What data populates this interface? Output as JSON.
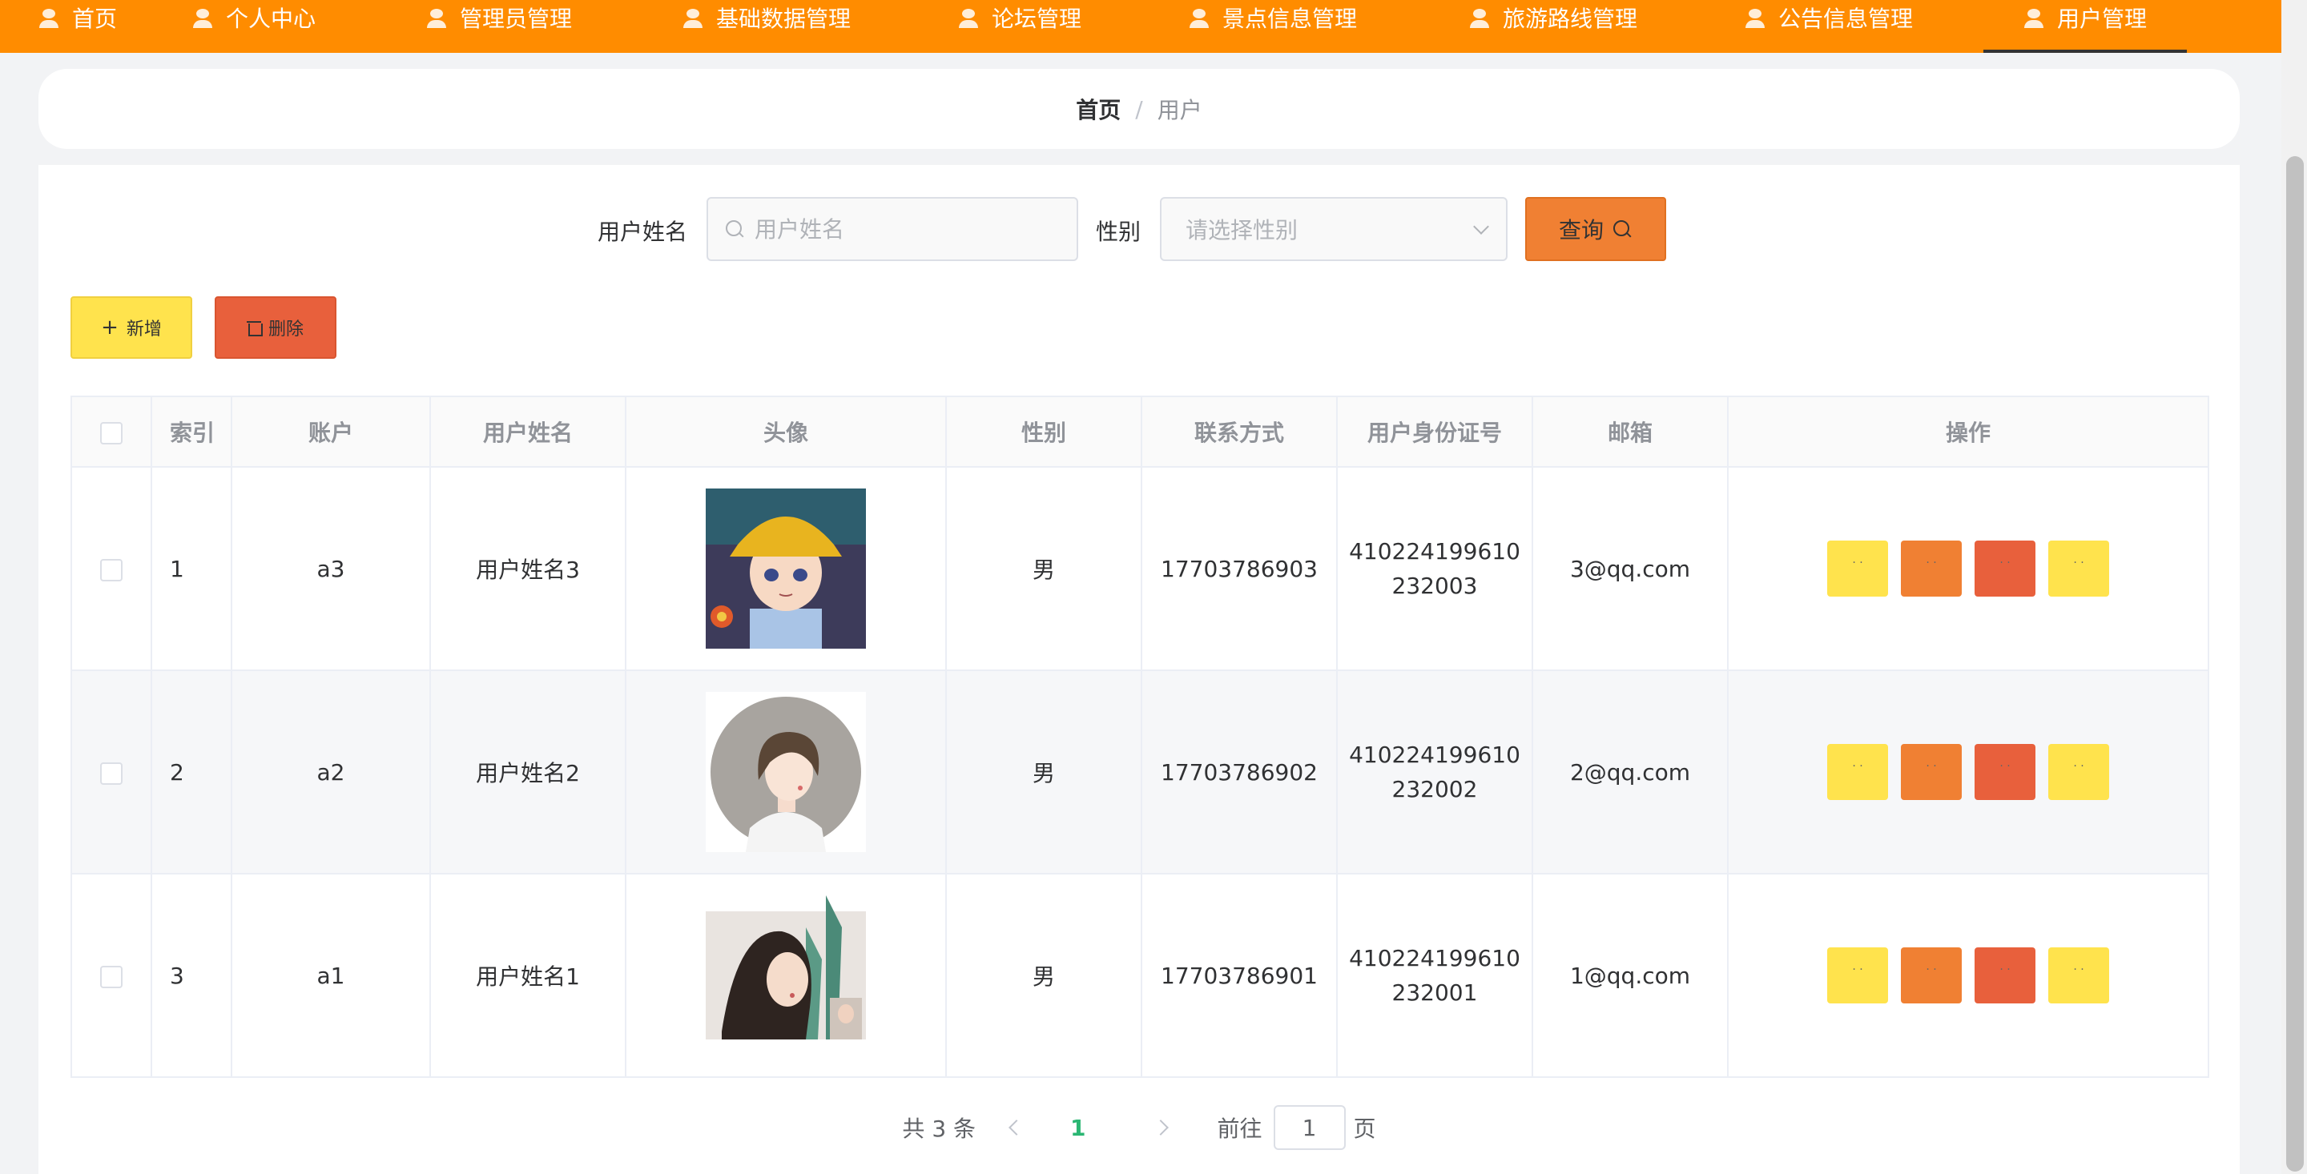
{
  "nav": {
    "items": [
      {
        "label": "首页",
        "icon": "home-icon"
      },
      {
        "label": "个人中心",
        "icon": "user-icon"
      },
      {
        "label": "管理员管理",
        "icon": "user-icon"
      },
      {
        "label": "基础数据管理",
        "icon": "location-icon"
      },
      {
        "label": "论坛管理",
        "icon": "forum-icon"
      },
      {
        "label": "景点信息管理",
        "icon": "user-icon"
      },
      {
        "label": "旅游路线管理",
        "icon": "user-icon"
      },
      {
        "label": "公告信息管理",
        "icon": "notice-icon"
      },
      {
        "label": "用户管理",
        "icon": "user-icon"
      }
    ],
    "active": "用户管理",
    "bg_color": "#ff8c00"
  },
  "breadcrumb": {
    "home": "首页",
    "separator": "/",
    "current": "用户"
  },
  "search": {
    "name_label": "用户姓名",
    "name_placeholder": "用户姓名",
    "gender_label": "性别",
    "gender_placeholder": "请选择性别",
    "query_label": "查询"
  },
  "actions": {
    "add_label": "新增",
    "delete_label": "删除"
  },
  "table": {
    "headers": [
      "索引",
      "账户",
      "用户姓名",
      "头像",
      "性别",
      "联系方式",
      "用户身份证号",
      "邮箱",
      "操作"
    ],
    "rows": [
      {
        "index": "1",
        "account": "a3",
        "name": "用户姓名3",
        "gender": "男",
        "phone": "17703786903",
        "id_line1": "410224199610",
        "id_line2": "232003",
        "email": "3@qq.com"
      },
      {
        "index": "2",
        "account": "a2",
        "name": "用户姓名2",
        "gender": "男",
        "phone": "17703786902",
        "id_line1": "410224199610",
        "id_line2": "232002",
        "email": "2@qq.com"
      },
      {
        "index": "3",
        "account": "a1",
        "name": "用户姓名1",
        "gender": "男",
        "phone": "17703786901",
        "id_line1": "410224199610",
        "id_line2": "232001",
        "email": "1@qq.com"
      }
    ]
  },
  "pagination": {
    "total_text": "共 3 条",
    "current_page": "1",
    "goto_label": "前往",
    "goto_value": "1",
    "page_unit": "页"
  },
  "colors": {
    "accent_orange": "#f08033",
    "accent_yellow": "#ffe34d",
    "accent_red": "#e8603c",
    "page_active": "#2bb673"
  }
}
